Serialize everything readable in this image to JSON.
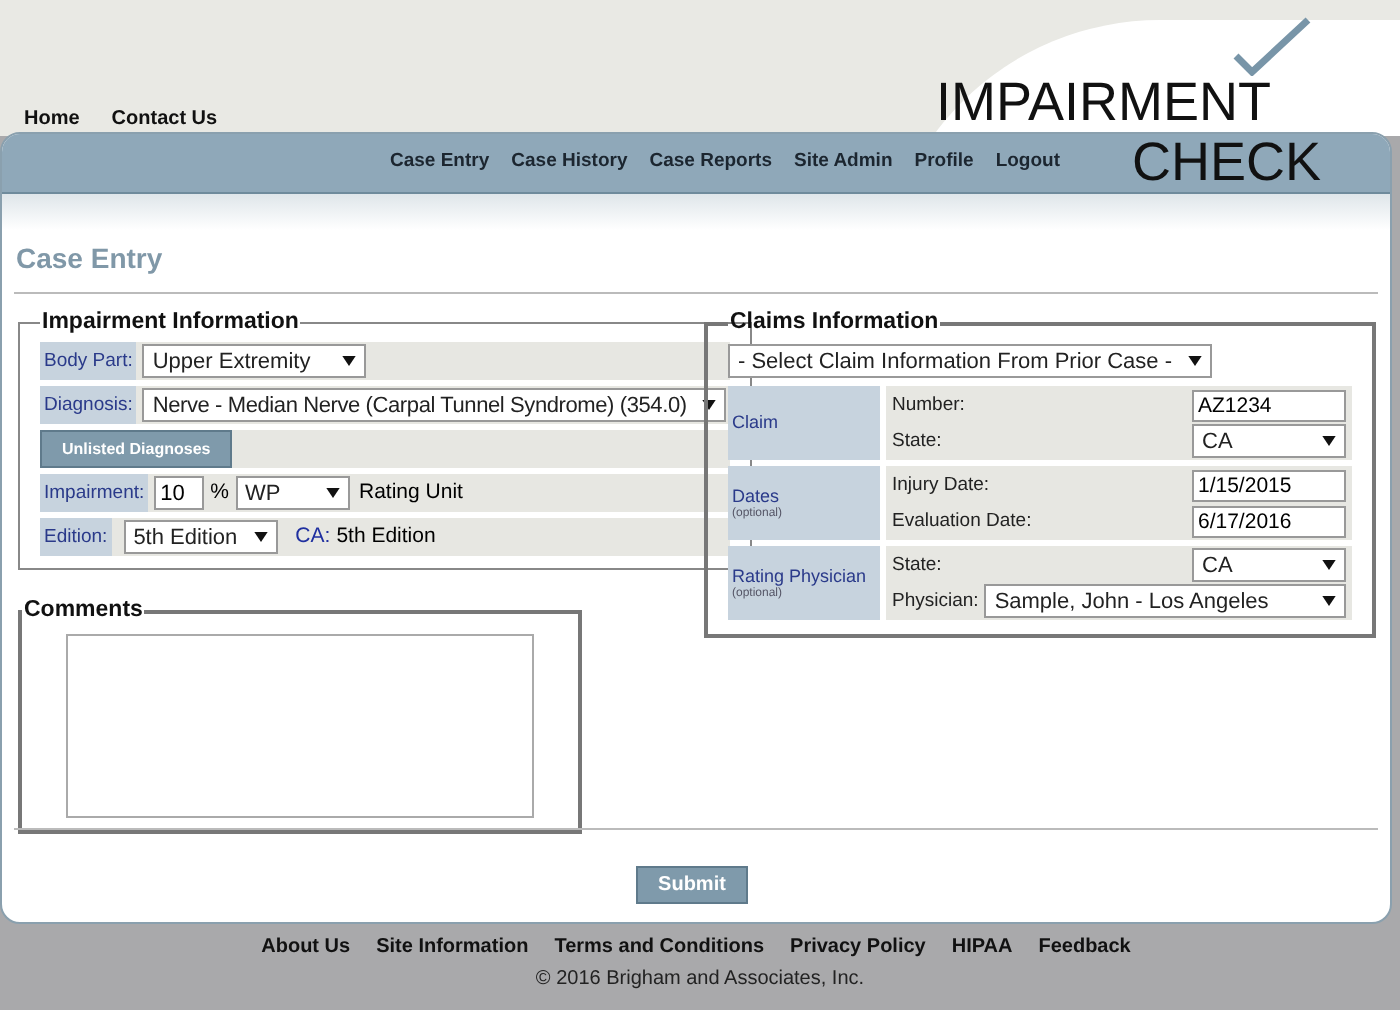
{
  "top_links": [
    "Home",
    "Contact Us"
  ],
  "logo": {
    "line1": "IMPAIRMENT",
    "line2": "CHECK"
  },
  "nav": [
    "Case Entry",
    "Case History",
    "Case Reports",
    "Site Admin",
    "Profile",
    "Logout"
  ],
  "page_title": "Case Entry",
  "impairment_info": {
    "legend": "Impairment Information",
    "body_part": {
      "label": "Body Part:",
      "value": "Upper Extremity"
    },
    "diagnosis": {
      "label": "Diagnosis:",
      "value": "Nerve - Median Nerve (Carpal Tunnel Syndrome) (354.0)"
    },
    "unlisted_button": "Unlisted Diagnoses",
    "impairment": {
      "label": "Impairment:",
      "value": "10",
      "unit_sign": "%",
      "unit": "WP",
      "unit_caption": "Rating Unit"
    },
    "edition": {
      "label": "Edition:",
      "value": "5th Edition",
      "state_label": "CA:",
      "state_edition": "5th Edition"
    }
  },
  "comments": {
    "legend": "Comments"
  },
  "claims_info": {
    "legend": "Claims Information",
    "prior_case": "- Select Claim Information From Prior Case -",
    "groups": [
      {
        "label": "Claim",
        "fields": [
          {
            "kind": "input",
            "label": "Number:",
            "value": "AZ1234"
          },
          {
            "kind": "select",
            "label": "State:",
            "value": "CA"
          }
        ]
      },
      {
        "label": "Dates",
        "note": "(optional)",
        "fields": [
          {
            "kind": "input",
            "label": "Injury Date:",
            "value": "1/15/2015"
          },
          {
            "kind": "input",
            "label": "Evaluation Date:",
            "value": "6/17/2016"
          }
        ]
      },
      {
        "label": "Rating Physician",
        "note": "(optional)",
        "fields": [
          {
            "kind": "select",
            "label": "State:",
            "value": "CA"
          },
          {
            "kind": "wide_select",
            "label": "Physician:",
            "value": "Sample, John - Los Angeles"
          }
        ]
      }
    ]
  },
  "submit": "Submit",
  "footer_links": [
    "About Us",
    "Site Information",
    "Terms and Conditions",
    "Privacy Policy",
    "HIPAA",
    "Feedback"
  ],
  "copyright": "© 2016 Brigham and Associates, Inc."
}
